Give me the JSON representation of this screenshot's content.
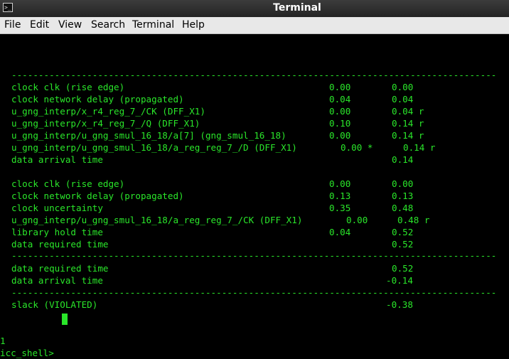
{
  "window": {
    "title": "Terminal",
    "icon": "terminal-icon"
  },
  "menu": [
    "File",
    "Edit",
    "View",
    "Search",
    "Terminal",
    "Help"
  ],
  "terminal": {
    "sep": "------------------------------------------------------------------------------------------",
    "lines": [
      {
        "t": "clock clk (rise edge)",
        "a": "0.00",
        "b": "0.00"
      },
      {
        "t": "clock network delay (propagated)",
        "a": "0.04",
        "b": "0.04"
      },
      {
        "t": "u_gng_interp/x_r4_reg_7_/CK (DFF_X1)",
        "a": "0.00",
        "b": "0.04 r"
      },
      {
        "t": "u_gng_interp/x_r4_reg_7_/Q (DFF_X1)",
        "a": "0.10",
        "b": "0.14 r"
      },
      {
        "t": "u_gng_interp/u_gng_smul_16_18/a[7] (gng_smul_16_18)",
        "a": "0.00",
        "b": "0.14 r"
      },
      {
        "t": "u_gng_interp/u_gng_smul_16_18/a_reg_reg_7_/D (DFF_X1)",
        "a": "0.00 *",
        "b": "0.14 r"
      },
      {
        "t": "data arrival time",
        "a": "",
        "b": "0.14"
      },
      {
        "t": "clock clk (rise edge)",
        "a": "0.00",
        "b": "0.00"
      },
      {
        "t": "clock network delay (propagated)",
        "a": "0.13",
        "b": "0.13"
      },
      {
        "t": "clock uncertainty",
        "a": "0.35",
        "b": "0.48"
      },
      {
        "t": "u_gng_interp/u_gng_smul_16_18/a_reg_reg_7_/CK (DFF_X1)",
        "a": "0.00",
        "b": "0.48 r"
      },
      {
        "t": "library hold time",
        "a": "0.04",
        "b": "0.52"
      },
      {
        "t": "data required time",
        "a": "",
        "b": "0.52"
      },
      {
        "t": "data required time",
        "a": "",
        "b": "0.52"
      },
      {
        "t": "data arrival time",
        "a": "",
        "b": "-0.14"
      },
      {
        "t": "slack (VIOLATED)",
        "a": "",
        "b": "-0.38"
      }
    ],
    "status": "1",
    "prompt": "icc_shell>"
  },
  "colors": {
    "fg": "#2ae62a",
    "bg": "#000000",
    "menubar": "#e8e8e8",
    "titlebar": "#2c2c2c"
  }
}
